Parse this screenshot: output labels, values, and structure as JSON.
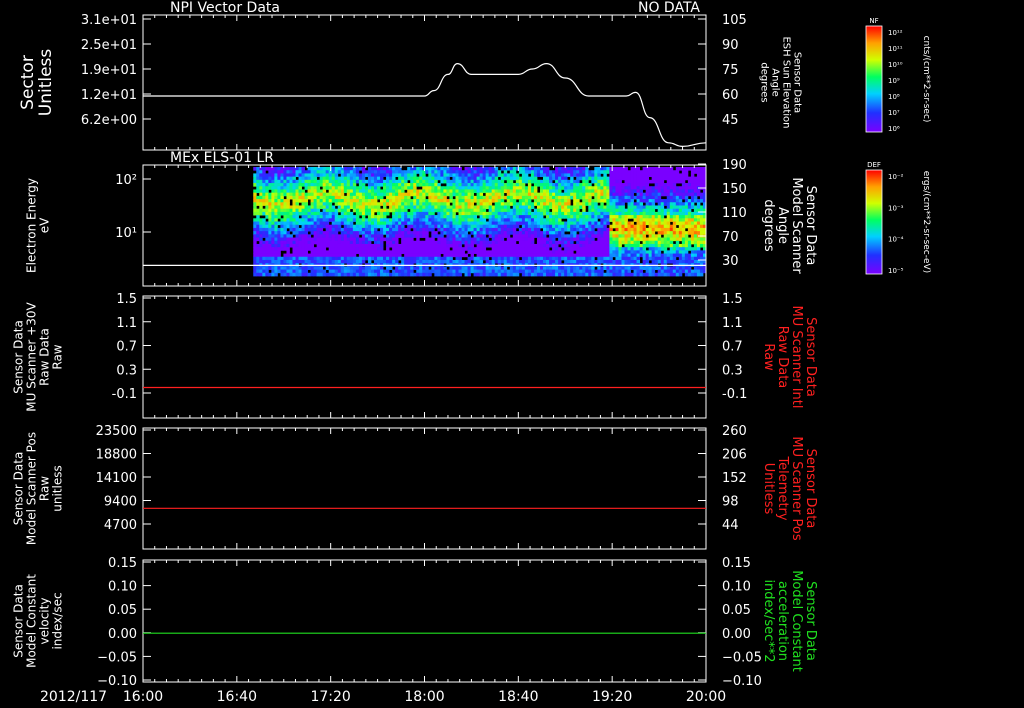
{
  "time_axis": {
    "date": "2012/117",
    "ticks": [
      "16:00",
      "16:40",
      "17:20",
      "18:00",
      "18:40",
      "19:20",
      "20:00"
    ]
  },
  "colors": {
    "background": "#000000",
    "text": "#ffffff",
    "red": "#ff2020",
    "green": "#20e020"
  },
  "colorbars": [
    {
      "id": "nf",
      "tag": "NF",
      "unit": "cnts/(cm**2-sr-sec)",
      "ticks": [
        "10¹²",
        "10¹¹",
        "10¹⁰",
        "10⁹",
        "10⁸",
        "10⁷",
        "10⁶"
      ]
    },
    {
      "id": "def",
      "tag": "DEF",
      "unit": "ergs/(cm**2-sr-sec-eV)",
      "ticks": [
        "10⁻²",
        "10⁻³",
        "10⁻⁴",
        "10⁻⁵"
      ]
    }
  ],
  "chart_data": [
    {
      "type": "line",
      "top_left_title": "NPI Vector Data",
      "top_right_title": "NO DATA",
      "ylabel_left": [
        "Sector",
        "Unitless"
      ],
      "left_ticks": [
        "3.1e+01",
        "2.5e+01",
        "1.9e+01",
        "1.2e+01",
        "6.2e+00"
      ],
      "ylabel_right": [
        "Sensor Data",
        "ESH Sun Elevation",
        "Angle",
        "degrees"
      ],
      "right_ticks": [
        "105",
        "90",
        "75",
        "60",
        "45"
      ],
      "right_ylim": [
        30,
        105
      ],
      "series": [
        {
          "color": "#ffffff",
          "axis": "right",
          "x": [
            "16:00",
            "18:00",
            "18:04",
            "18:10",
            "18:14",
            "18:20",
            "18:30",
            "18:40",
            "18:46",
            "18:52",
            "19:00",
            "19:10",
            "19:20",
            "19:26",
            "19:30",
            "19:36",
            "19:44",
            "19:50",
            "20:00"
          ],
          "y": [
            60,
            60,
            63,
            72,
            78,
            72,
            72,
            72,
            75,
            78,
            70,
            60,
            60,
            60,
            62,
            48,
            34,
            32,
            34
          ]
        }
      ]
    },
    {
      "type": "heatmap",
      "top_left_title": "MEx ELS-01 LR",
      "ylabel_left": [
        "Electron Energy",
        "eV"
      ],
      "left_ticks": [
        "10²",
        "10¹"
      ],
      "ylabel_right": [
        "Sensor Data",
        "Model Scanner",
        "Angle",
        "degrees"
      ],
      "right_ticks": [
        "190",
        "150",
        "110",
        "70",
        "30"
      ],
      "data_start": "16:47",
      "series": [
        {
          "color": "#ffffff",
          "axis": "right",
          "x": [
            "16:00",
            "20:00"
          ],
          "y": [
            21,
            21
          ]
        }
      ]
    },
    {
      "type": "line",
      "ylabel_left": [
        "Sensor Data",
        "MU Scanner +30V",
        "Raw Data",
        "Raw"
      ],
      "left_ticks": [
        "1.5",
        "1.1",
        "0.7",
        "0.3",
        "-0.1"
      ],
      "left_ylim": [
        -0.5,
        1.5
      ],
      "ylabel_right": [
        "Sensor Data",
        "MU Scanner Intl",
        "Raw Data",
        "Raw"
      ],
      "ylabel_right_color": "#ff2020",
      "right_ticks": [
        "1.5",
        "1.1",
        "0.7",
        "0.3",
        "-0.1"
      ],
      "series": [
        {
          "color": "#ff2020",
          "axis": "left",
          "x": [
            "16:00",
            "20:00"
          ],
          "y": [
            0.0,
            0.0
          ]
        }
      ]
    },
    {
      "type": "line",
      "ylabel_left": [
        "Sensor Data",
        "Model Scanner Pos",
        "Raw",
        "unitless"
      ],
      "left_ticks": [
        "23500",
        "18800",
        "14100",
        "9400",
        "4700"
      ],
      "left_ylim": [
        0,
        23500
      ],
      "ylabel_right": [
        "Sensor Data",
        "MU Scanner Pos",
        "Telemetry",
        "Unitless"
      ],
      "ylabel_right_color": "#ff2020",
      "right_ticks": [
        "260",
        "206",
        "152",
        "98",
        "44"
      ],
      "series": [
        {
          "color": "#ff2020",
          "axis": "left",
          "x": [
            "16:00",
            "20:00"
          ],
          "y": [
            7900,
            7900
          ]
        }
      ]
    },
    {
      "type": "line",
      "ylabel_left": [
        "Sensor Data",
        "Model Constant",
        "velocity",
        "index/sec"
      ],
      "left_ticks": [
        "0.15",
        "0.10",
        "0.05",
        "0.00",
        "−0.05",
        "−0.10"
      ],
      "left_ylim": [
        -0.1,
        0.15
      ],
      "ylabel_right": [
        "Sensor Data",
        "Model Constant",
        "acceleration",
        "index/sec**2"
      ],
      "ylabel_right_color": "#20e020",
      "right_ticks": [
        "0.15",
        "0.10",
        "0.05",
        "0.00",
        "−0.05",
        "−0.10"
      ],
      "series": [
        {
          "color": "#20e020",
          "axis": "left",
          "x": [
            "16:00",
            "20:00"
          ],
          "y": [
            0.0,
            0.0
          ]
        }
      ]
    }
  ]
}
